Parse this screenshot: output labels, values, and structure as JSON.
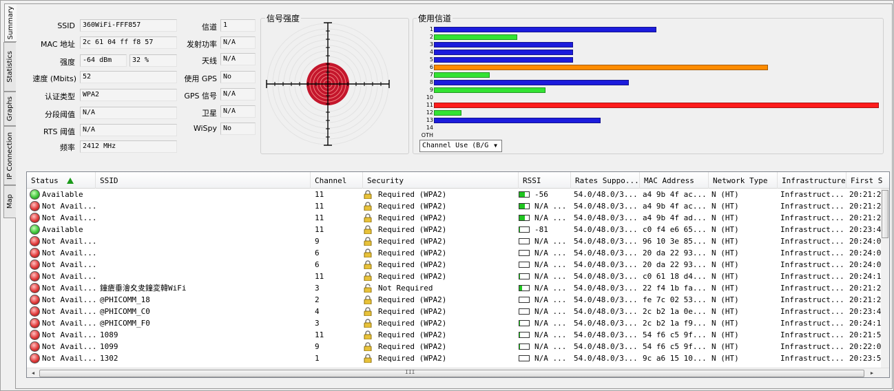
{
  "tabs": [
    "Summary",
    "Statistics",
    "Graphs",
    "IP Connection",
    "Map"
  ],
  "info": {
    "ssid_label": "SSID",
    "ssid": "360WiFi-FFF857",
    "mac_label": "MAC 地址",
    "mac": "2c 61 04 ff f8 57",
    "strength_label": "强度",
    "strength_dbm": "-64 dBm",
    "strength_pct": "32 %",
    "speed_label": "速度 (Mbits)",
    "speed": "52",
    "auth_label": "认证类型",
    "auth": "WPA2",
    "frag_label": "分段阈值",
    "frag": "N/A",
    "rts_label": "RTS 阈值",
    "rts": "N/A",
    "freq_label": "频率",
    "freq": "2412 MHz",
    "channel_label": "信道",
    "channel": "1",
    "txpower_label": "发射功率",
    "txpower": "N/A",
    "antenna_label": "天线",
    "antenna": "N/A",
    "gps_label": "使用 GPS",
    "gps": "No",
    "gps_signal_label": "GPS 信号",
    "gps_signal": "N/A",
    "satellite_label": "卫星",
    "satellite": "N/A",
    "wispy_label": "WiSpy",
    "wispy": "No"
  },
  "signal": {
    "title": "信号强度"
  },
  "channel_usage": {
    "title": "使用信道",
    "select_value": "Channel Use (B/G",
    "chart_data": {
      "type": "bar",
      "orientation": "horizontal",
      "categories": [
        "1",
        "2",
        "3",
        "4",
        "5",
        "6",
        "7",
        "8",
        "9",
        "10",
        "11",
        "12",
        "13",
        "14",
        "OTH"
      ],
      "values": [
        16,
        6,
        10,
        10,
        10,
        24,
        4,
        14,
        8,
        0,
        32,
        2,
        12,
        0,
        0
      ],
      "colors": [
        "#1c1cdc",
        "#33e333",
        "#1c1cdc",
        "#1c1cdc",
        "#1c1cdc",
        "#ff8c00",
        "#33e333",
        "#1c1cdc",
        "#33e333",
        "#1c1cdc",
        "#ff1c1c",
        "#33e333",
        "#1c1cdc",
        "#1c1cdc",
        "#1c1cdc"
      ],
      "xlim": [
        0,
        32
      ]
    }
  },
  "table": {
    "headers": [
      "Status",
      "SSID",
      "Channel",
      "Security",
      "RSSI",
      "Rates Suppo...",
      "MAC Address",
      "Network Type",
      "Infrastructure",
      "First S"
    ],
    "rows": [
      {
        "status": "Available",
        "ok": true,
        "ssid": "",
        "channel": "11",
        "secure": true,
        "security": "Required (WPA2)",
        "rssi": "-56",
        "rssi_level": 0.6,
        "rates": "54.0/48.0/3...",
        "mac": "a4 9b 4f ac...",
        "type": "N (HT)",
        "infra": "Infrastruct...",
        "first": "20:21:2"
      },
      {
        "status": "Not Avail...",
        "ok": false,
        "ssid": "",
        "channel": "11",
        "secure": true,
        "security": "Required (WPA2)",
        "rssi": "N/A ...",
        "rssi_level": 0.6,
        "rates": "54.0/48.0/3...",
        "mac": "a4 9b 4f ac...",
        "type": "N (HT)",
        "infra": "Infrastruct...",
        "first": "20:21:2"
      },
      {
        "status": "Not Avail...",
        "ok": false,
        "ssid": "",
        "channel": "11",
        "secure": true,
        "security": "Required (WPA2)",
        "rssi": "N/A ...",
        "rssi_level": 0.6,
        "rates": "54.0/48.0/3...",
        "mac": "a4 9b 4f ad...",
        "type": "N (HT)",
        "infra": "Infrastruct...",
        "first": "20:21:2"
      },
      {
        "status": "Available",
        "ok": true,
        "ssid": "",
        "channel": "11",
        "secure": true,
        "security": "Required (WPA2)",
        "rssi": "-81",
        "rssi_level": 0.1,
        "rates": "54.0/48.0/3...",
        "mac": "c0 f4 e6 65...",
        "type": "N (HT)",
        "infra": "Infrastruct...",
        "first": "20:23:4"
      },
      {
        "status": "Not Avail...",
        "ok": false,
        "ssid": "",
        "channel": "9",
        "secure": true,
        "security": "Required (WPA2)",
        "rssi": "N/A ...",
        "rssi_level": 0,
        "rates": "54.0/48.0/3...",
        "mac": "96 10 3e 85...",
        "type": "N (HT)",
        "infra": "Infrastruct...",
        "first": "20:24:0"
      },
      {
        "status": "Not Avail...",
        "ok": false,
        "ssid": "",
        "channel": "6",
        "secure": true,
        "security": "Required (WPA2)",
        "rssi": "N/A ...",
        "rssi_level": 0,
        "rates": "54.0/48.0/3...",
        "mac": "20 da 22 93...",
        "type": "N (HT)",
        "infra": "Infrastruct...",
        "first": "20:24:0"
      },
      {
        "status": "Not Avail...",
        "ok": false,
        "ssid": "",
        "channel": "6",
        "secure": true,
        "security": "Required (WPA2)",
        "rssi": "N/A ...",
        "rssi_level": 0,
        "rates": "54.0/48.0/3...",
        "mac": "20 da 22 93...",
        "type": "N (HT)",
        "infra": "Infrastruct...",
        "first": "20:24:0"
      },
      {
        "status": "Not Avail...",
        "ok": false,
        "ssid": "",
        "channel": "11",
        "secure": true,
        "security": "Required (WPA2)",
        "rssi": "N/A ...",
        "rssi_level": 0.1,
        "rates": "54.0/48.0/3...",
        "mac": "c0 61 18 d4...",
        "type": "N (HT)",
        "infra": "Infrastruct...",
        "first": "20:24:1"
      },
      {
        "status": "Not Avail...",
        "ok": false,
        "ssid": "鐘瘡垂澮夊叏鐘変韓WiFi",
        "channel": "3",
        "secure": false,
        "security": "Not Required",
        "rssi": "N/A ...",
        "rssi_level": 0.3,
        "rates": "54.0/48.0/3...",
        "mac": "22 f4 1b fa...",
        "type": "N (HT)",
        "infra": "Infrastruct...",
        "first": "20:21:2"
      },
      {
        "status": "Not Avail...",
        "ok": false,
        "ssid": "@PHICOMM_18",
        "channel": "2",
        "secure": true,
        "security": "Required (WPA2)",
        "rssi": "N/A ...",
        "rssi_level": 0,
        "rates": "54.0/48.0/3...",
        "mac": "fe 7c 02 53...",
        "type": "N (HT)",
        "infra": "Infrastruct...",
        "first": "20:21:2"
      },
      {
        "status": "Not Avail...",
        "ok": false,
        "ssid": "@PHICOMM_C0",
        "channel": "4",
        "secure": true,
        "security": "Required (WPA2)",
        "rssi": "N/A ...",
        "rssi_level": 0,
        "rates": "54.0/48.0/3...",
        "mac": "2c b2 1a 0e...",
        "type": "N (HT)",
        "infra": "Infrastruct...",
        "first": "20:23:4"
      },
      {
        "status": "Not Avail...",
        "ok": false,
        "ssid": "@PHICOMM_F0",
        "channel": "3",
        "secure": true,
        "security": "Required (WPA2)",
        "rssi": "N/A ...",
        "rssi_level": 0.1,
        "rates": "54.0/48.0/3...",
        "mac": "2c b2 1a f9...",
        "type": "N (HT)",
        "infra": "Infrastruct...",
        "first": "20:24:1"
      },
      {
        "status": "Not Avail...",
        "ok": false,
        "ssid": "1089",
        "channel": "11",
        "secure": true,
        "security": "Required (WPA2)",
        "rssi": "N/A ...",
        "rssi_level": 0.1,
        "rates": "54.0/48.0/3...",
        "mac": "54 f6 c5 9f...",
        "type": "N (HT)",
        "infra": "Infrastruct...",
        "first": "20:21:5"
      },
      {
        "status": "Not Avail...",
        "ok": false,
        "ssid": "1099",
        "channel": "9",
        "secure": true,
        "security": "Required (WPA2)",
        "rssi": "N/A ...",
        "rssi_level": 0.1,
        "rates": "54.0/48.0/3...",
        "mac": "54 f6 c5 9f...",
        "type": "N (HT)",
        "infra": "Infrastruct...",
        "first": "20:22:0"
      },
      {
        "status": "Not Avail...",
        "ok": false,
        "ssid": "1302",
        "channel": "1",
        "secure": true,
        "security": "Required (WPA2)",
        "rssi": "N/A ...",
        "rssi_level": 0,
        "rates": "54.0/48.0/3...",
        "mac": "9c a6 15 10...",
        "type": "N (HT)",
        "infra": "Infrastruct...",
        "first": "20:23:5"
      }
    ]
  },
  "scroll_grip": "III"
}
